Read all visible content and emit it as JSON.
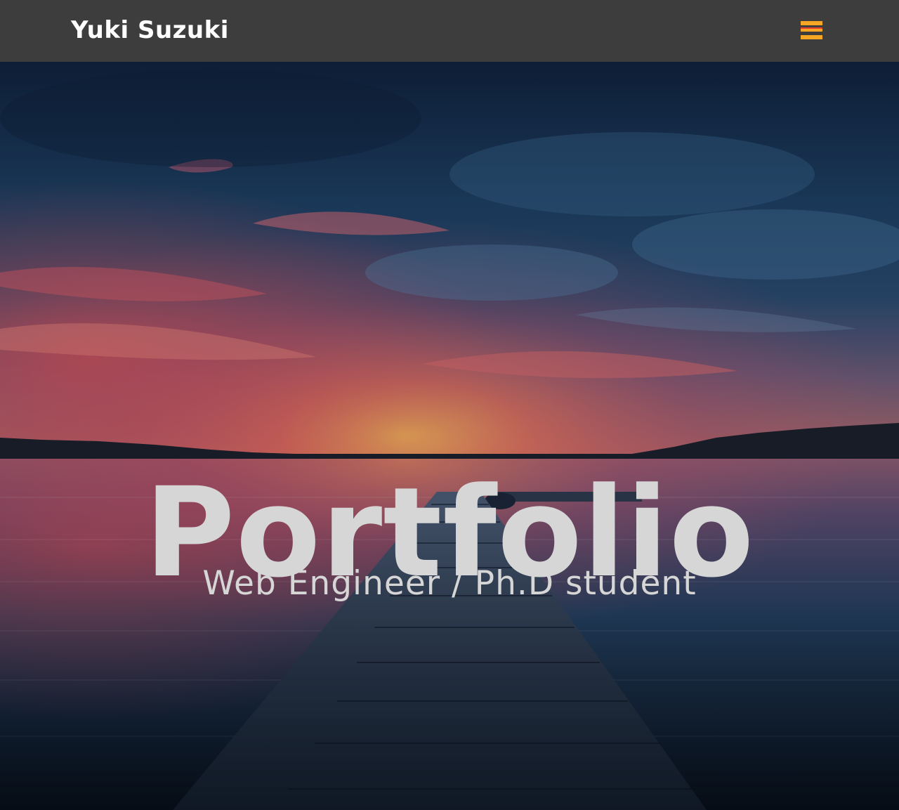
{
  "navbar": {
    "brand": "Yuki Suzuki",
    "menu_icon": "hamburger-menu-icon",
    "menu_icon_colors": [
      "#f5a623",
      "#e8402f",
      "#f5a623"
    ]
  },
  "hero": {
    "title": "Portfolio",
    "subtitle": "Web Engineer / Ph.D student",
    "background_image": "sunset-lake-pier-photo"
  },
  "colors": {
    "navbar_bg": "#3d3d3d",
    "hero_text": "#d6d6d6",
    "menu_accent": "#f5a623"
  }
}
